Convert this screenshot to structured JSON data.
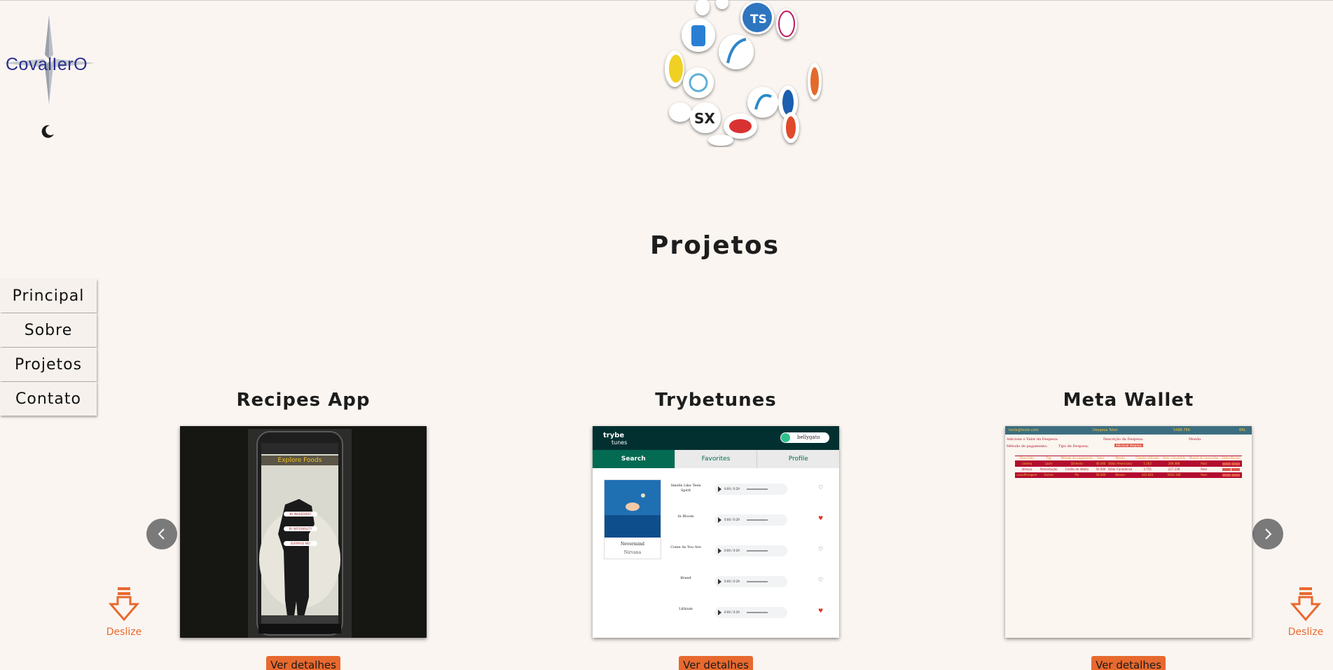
{
  "logo": {
    "text": "CovalIerO"
  },
  "nav": {
    "items": [
      {
        "label": "Principal"
      },
      {
        "label": "Sobre"
      },
      {
        "label": "Projetos"
      },
      {
        "label": "Contato"
      }
    ]
  },
  "section": {
    "title": "Projetos"
  },
  "projects": [
    {
      "title": "Recipes App",
      "button": "Ver detalhes",
      "preview": {
        "heading": "Explore Foods",
        "buttons": [
          "BY INGREDIENT",
          "BY NATIONALITY",
          "SURPRISE ME!"
        ]
      }
    },
    {
      "title": "Trybetunes",
      "button": "Ver detalhes",
      "preview": {
        "brand_top": "trybe",
        "brand_bottom": "tunes",
        "user": "bellygato",
        "tabs": [
          "Search",
          "Favorites",
          "Profile"
        ],
        "album": "Nevermind",
        "artist": "Nirvana",
        "time": "0:00 / 0:29",
        "songs": [
          "Smells Like Teen Spirit",
          "In Bloom",
          "Come As You Are",
          "Breed",
          "Lithium"
        ]
      }
    },
    {
      "title": "Meta Wallet",
      "button": "Ver detalhes",
      "preview": {
        "email": "teste@teste.com",
        "total": "Despesa Total:",
        "amount": "5488.766",
        "currency": "BRL",
        "form_label": "Adicione o Valor da Despesa:",
        "desc_label": "Descrição da Despesa:",
        "coin_label": "Moeda",
        "method_label": "Método de pagamento:",
        "tag_label": "Tipo de Despesa:",
        "add_button": "Adicionar despesa",
        "headers": [
          "Descrição",
          "Tag",
          "Método de pagamento",
          "Valor",
          "Moeda",
          "Câmbio utilizado",
          "Valor convertido",
          "Moeda de conversão",
          "Editar/Excluir"
        ],
        "rows": [
          [
            "cinema",
            "Lazer",
            "Dinheiro",
            "40.000",
            "Dólar Americano",
            "5.163",
            "206.488",
            "Real"
          ],
          [
            "almoço",
            "Alimentação",
            "Cartão de débito",
            "50.000",
            "Dólar Canadense",
            "3.755",
            "227.238",
            "Real"
          ],
          [
            "casa/filmagem",
            "Outros",
            "Pix",
            "50.000",
            "Bitcoin",
            "101.003",
            "5050.100",
            "Real"
          ]
        ]
      }
    }
  ],
  "scroll_hint": {
    "label": "Deslize"
  },
  "colors": {
    "accent": "#e8692e",
    "background": "#faf5f1",
    "wallet_red": "#b30d2f",
    "tunes_green": "#036b52"
  }
}
